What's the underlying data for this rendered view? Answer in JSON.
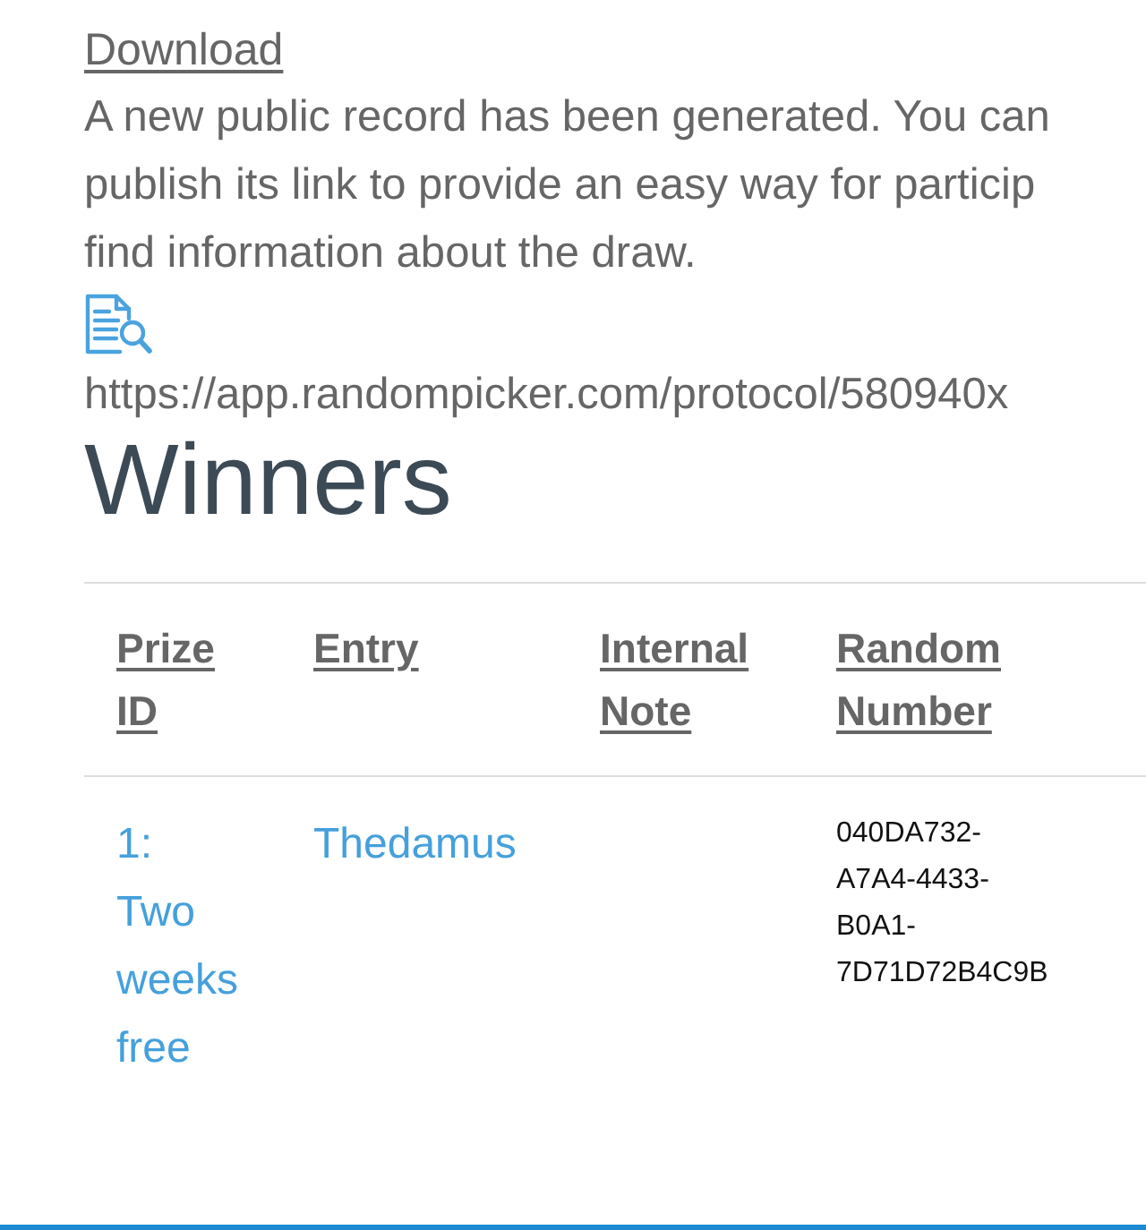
{
  "download_link": {
    "label": "Download"
  },
  "notice": {
    "lines": [
      "A new public record has been generated. You can",
      "publish its link to provide an easy way for particip",
      "find information about the draw."
    ]
  },
  "protocol": {
    "url": "https://app.randompicker.com/protocol/580940x"
  },
  "winners": {
    "title": "Winners",
    "columns": [
      {
        "label": "Prize ID"
      },
      {
        "label": "Entry"
      },
      {
        "label": "Internal Note"
      },
      {
        "label": "Random Number"
      }
    ],
    "rows": [
      {
        "prize": "1: Two weeks free",
        "entry": "Thedamus",
        "random_number": "040DA732-A7A4-4433-B0A1-7D71D72B4C9B"
      }
    ]
  }
}
